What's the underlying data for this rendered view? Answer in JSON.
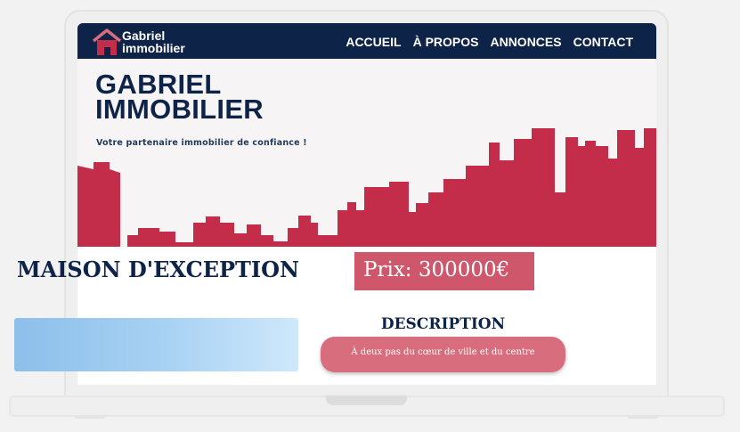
{
  "nav": {
    "logo_line1": "Gabriel",
    "logo_line2": "immobilier",
    "links": [
      "ACCUEIL",
      "À PROPOS",
      "ANNONCES",
      "CONTACT"
    ]
  },
  "hero": {
    "title_line1": "GABRIEL",
    "title_line2": "IMMOBILIER",
    "subtitle": "Votre partenaire immobilier de confiance !"
  },
  "listing": {
    "title": "MAISON D'EXCEPTION",
    "price": "Prix: 300000€",
    "description_heading": "DESCRIPTION",
    "description_text": "À deux pas du cœur de ville et du centre"
  },
  "colors": {
    "navy": "#0d2347",
    "crimson": "#c42d4a",
    "price_bg": "#cf576c",
    "desc_bg": "#d86d7d"
  }
}
